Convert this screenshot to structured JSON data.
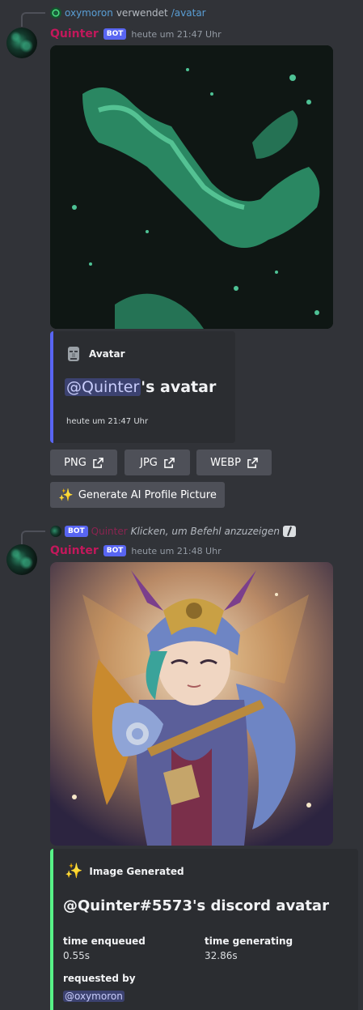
{
  "message1": {
    "reply": {
      "user": "oxymoron",
      "action": "verwendet",
      "command": "/avatar"
    },
    "author": "Quinter",
    "bot_badge": "BOT",
    "timestamp": "heute um 21:47 Uhr",
    "embed": {
      "author_name": "Avatar",
      "title_mention": "@Quinter",
      "title_rest": "'s avatar",
      "footer": "heute um 21:47 Uhr"
    },
    "buttons": [
      {
        "label": "PNG",
        "icon": "external-link-icon"
      },
      {
        "label": "JPG",
        "icon": "external-link-icon"
      },
      {
        "label": "WEBP",
        "icon": "external-link-icon"
      }
    ],
    "generate_button": {
      "label": "Generate AI Profile Picture",
      "icon": "sparkles-icon"
    }
  },
  "message2": {
    "reply": {
      "bot_badge": "BOT",
      "user": "Quinter",
      "text": "Klicken, um Befehl anzuzeigen"
    },
    "author": "Quinter",
    "bot_badge": "BOT",
    "timestamp": "heute um 21:48 Uhr",
    "embed": {
      "author_name": "Image Generated",
      "title": "@Quinter#5573's discord avatar",
      "fields": [
        {
          "name": "time enqueued",
          "value": "0.55s"
        },
        {
          "name": "time generating",
          "value": "32.86s"
        }
      ],
      "requested_by_label": "requested by",
      "requested_by_value": "@oxymoron"
    }
  },
  "colors": {
    "embed_border_blue": "#5865f2",
    "embed_border_green": "#57f287",
    "username": "#c2185b",
    "background": "#313338"
  }
}
